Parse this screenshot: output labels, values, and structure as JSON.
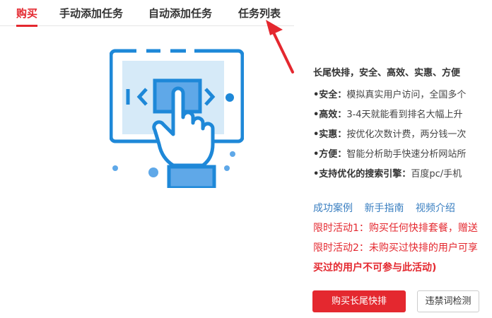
{
  "tabs": [
    {
      "label": "购买",
      "active": true
    },
    {
      "label": "手动添加任务",
      "active": false
    },
    {
      "label": "自动添加任务",
      "active": false
    },
    {
      "label": "任务列表",
      "active": false
    }
  ],
  "info": {
    "headline": "长尾快排，安全、高效、实惠、方便",
    "features": [
      {
        "label": "•安全：",
        "text": "模拟真实用户访问，全国多个"
      },
      {
        "label": "•高效：",
        "text": "3-4天就能看到排名大幅上升"
      },
      {
        "label": "•实惠：",
        "text": "按优化次数计费，两分钱一次"
      },
      {
        "label": "•方便：",
        "text": "智能分析助手快速分析网站所"
      },
      {
        "label": "•支持优化的搜索引擎：",
        "text": "百度pc/手机"
      }
    ]
  },
  "links": [
    "成功案例",
    "新手指南",
    "视频介绍"
  ],
  "promos": [
    "限时活动1：购买任何快排套餐，赠送",
    "限时活动2：未购买过快排的用户可享",
    "买过的用户不可参与此活动)"
  ],
  "buttons": {
    "buy": "购买长尾快排",
    "check": "违禁词检测"
  },
  "colors": {
    "accent": "#e4282f",
    "link": "#3a7fc1",
    "illustration_blue": "#1e88d8",
    "illustration_light": "#d6eaf8"
  },
  "icons": {
    "arrow": "red-pointer-arrow-icon",
    "illustration": "touch-screen-swipe-icon"
  }
}
